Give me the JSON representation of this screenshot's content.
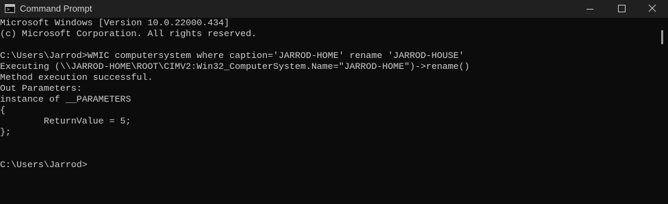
{
  "window": {
    "title": "Command Prompt",
    "icon": "cmd-prompt-icon",
    "controls": [
      "minimize-icon",
      "maximize-icon",
      "close-icon"
    ]
  },
  "console": {
    "lines": [
      "Microsoft Windows [Version 10.0.22000.434]",
      "(c) Microsoft Corporation. All rights reserved.",
      "",
      "C:\\Users\\Jarrod>WMIC computersystem where caption='JARROD-HOME' rename 'JARROD-HOUSE'",
      "Executing (\\\\JARROD-HOME\\ROOT\\CIMV2:Win32_ComputerSystem.Name=\"JARROD-HOME\")->rename()",
      "Method execution successful.",
      "Out Parameters:",
      "instance of __PARAMETERS",
      "{",
      "        ReturnValue = 5;",
      "};",
      "",
      "",
      "C:\\Users\\Jarrod>"
    ]
  },
  "colors": {
    "background": "#0c0c0c",
    "titlebar": "#202020",
    "text": "#cccccc"
  }
}
